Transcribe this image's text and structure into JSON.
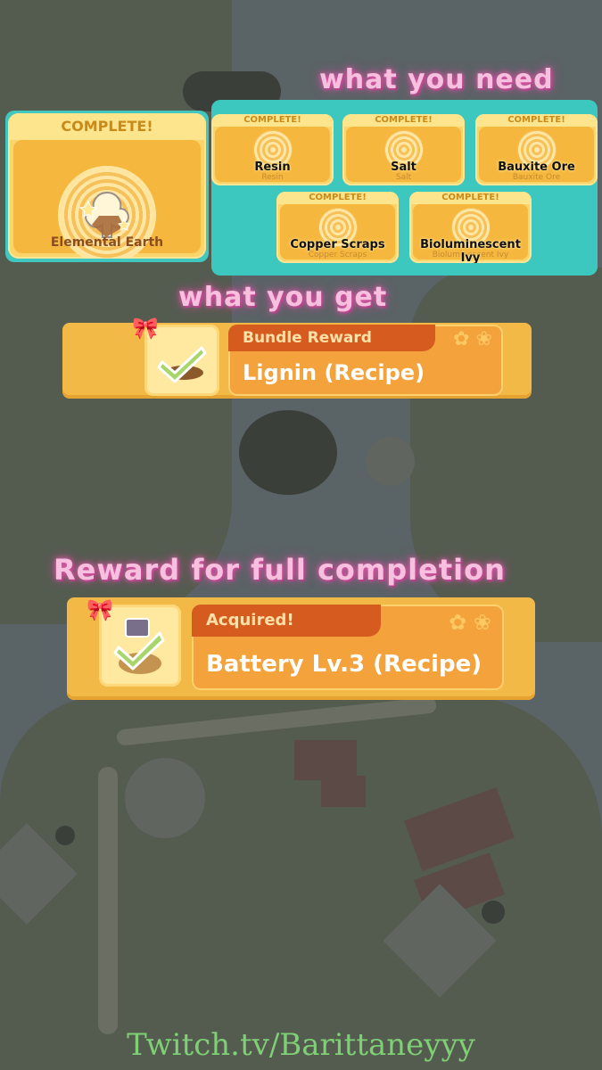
{
  "headings": {
    "what_you_need": "what you need",
    "what_you_get": "what you get",
    "full_completion": "Reward for full completion"
  },
  "bundle": {
    "status": "COMPLETE!",
    "name": "Elemental Earth",
    "icon": "elemental-earth-icon"
  },
  "ingredients": [
    {
      "status": "COMPLETE!",
      "name": "Resin",
      "icon": "resin-icon"
    },
    {
      "status": "COMPLETE!",
      "name": "Salt",
      "icon": "salt-icon"
    },
    {
      "status": "COMPLETE!",
      "name": "Bauxite Ore",
      "icon": "bauxite-ore-icon"
    },
    {
      "status": "COMPLETE!",
      "name": "Copper Scraps",
      "icon": "copper-scraps-icon"
    },
    {
      "status": "COMPLETE!",
      "name": "Bioluminescent Ivy",
      "icon": "bioluminescent-ivy-icon"
    }
  ],
  "bundle_reward": {
    "tag": "Bundle Reward",
    "item": "Lignin (Recipe)",
    "icon": "recipe-check-icon"
  },
  "full_reward": {
    "tag": "Acquired!",
    "item": "Battery Lv.3 (Recipe)",
    "icon": "battery-recipe-icon"
  },
  "footer": "Twitch.tv/Barittaneyyy",
  "colors": {
    "teal": "#3cc8bf",
    "card_yellow": "#fbd46a",
    "reward_orange": "#d55b1f",
    "heading_pink": "#f7c0de",
    "footer_green": "#7fcf75"
  }
}
